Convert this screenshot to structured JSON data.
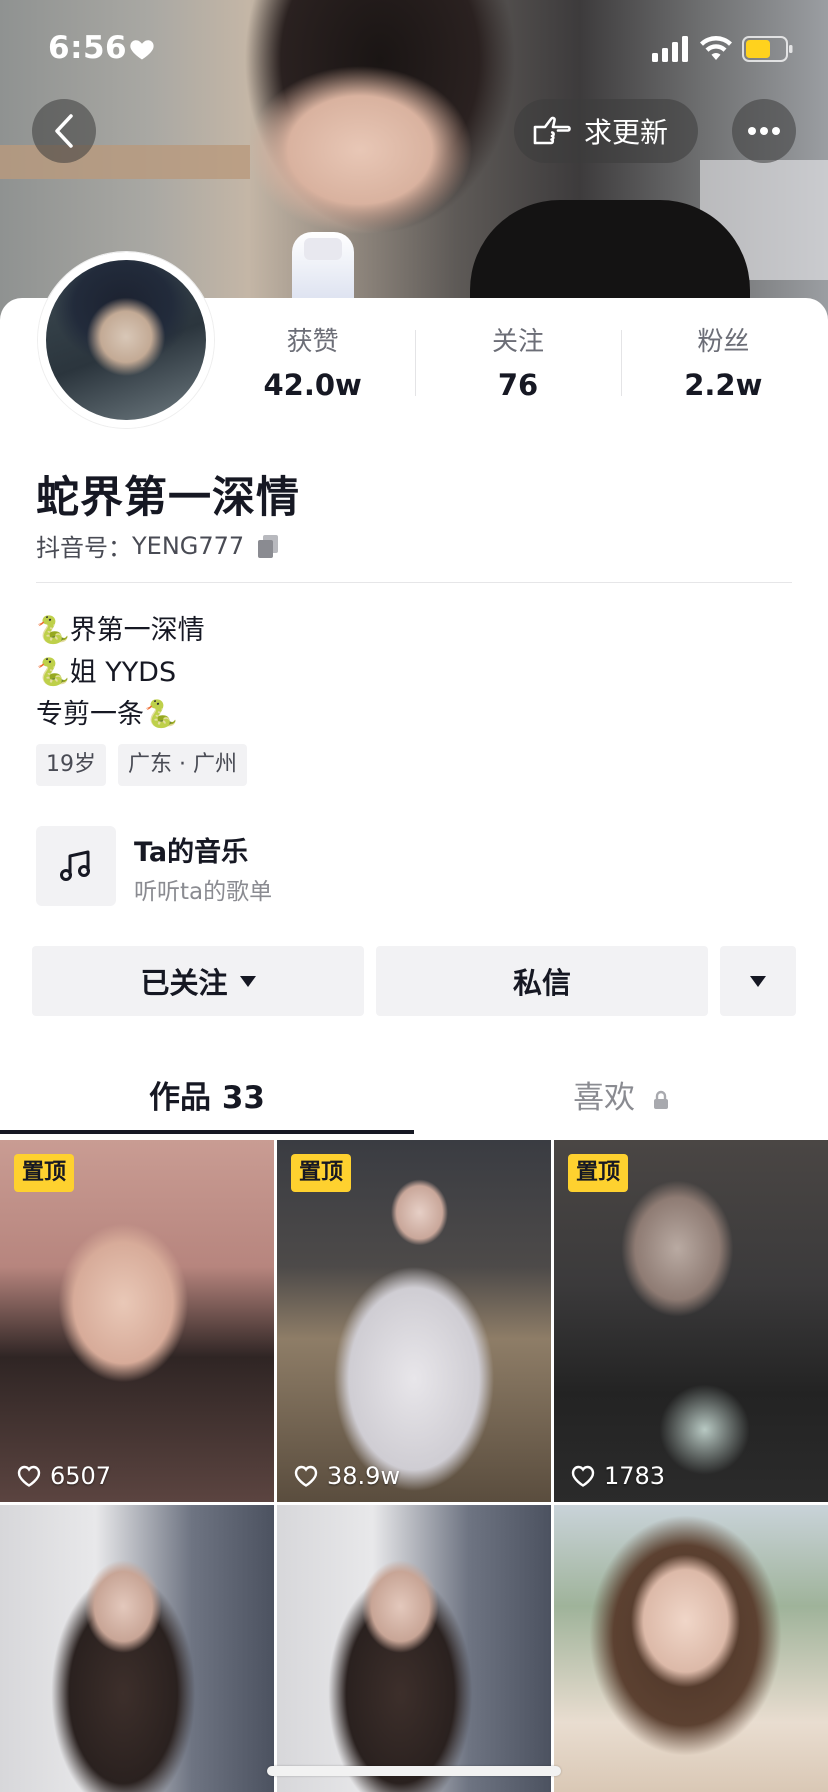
{
  "status_bar": {
    "time": "6:56"
  },
  "top_controls": {
    "update_label": "求更新"
  },
  "profile": {
    "stats": [
      {
        "label": "获赞",
        "value": "42.0w"
      },
      {
        "label": "关注",
        "value": "76"
      },
      {
        "label": "粉丝",
        "value": "2.2w"
      }
    ],
    "nickname": "蛇界第一深情",
    "douyin_id_label": "抖音号：",
    "douyin_id": "YENG777",
    "bio_lines": [
      "🐍界第一深情",
      "🐍姐 YYDS",
      "专剪一条🐍"
    ],
    "tags": [
      "19岁",
      "广东 · 广州"
    ],
    "music": {
      "title": "Ta的音乐",
      "subtitle": "听听ta的歌单"
    }
  },
  "actions": {
    "follow_label": "已关注",
    "message_label": "私信"
  },
  "tabs": [
    {
      "label": "作品 33",
      "active": true
    },
    {
      "label": "喜欢",
      "active": false,
      "locked": true
    }
  ],
  "videos": [
    {
      "pinned": true,
      "pin_label": "置顶",
      "likes": "6507"
    },
    {
      "pinned": true,
      "pin_label": "置顶",
      "likes": "38.9w"
    },
    {
      "pinned": true,
      "pin_label": "置顶",
      "likes": "1783"
    },
    {
      "pinned": false,
      "likes": ""
    },
    {
      "pinned": false,
      "likes": ""
    },
    {
      "pinned": false,
      "likes": ""
    }
  ],
  "colors": {
    "pin_badge": "#fed12f",
    "text_primary": "#161823",
    "button_bg": "#f2f2f4"
  }
}
